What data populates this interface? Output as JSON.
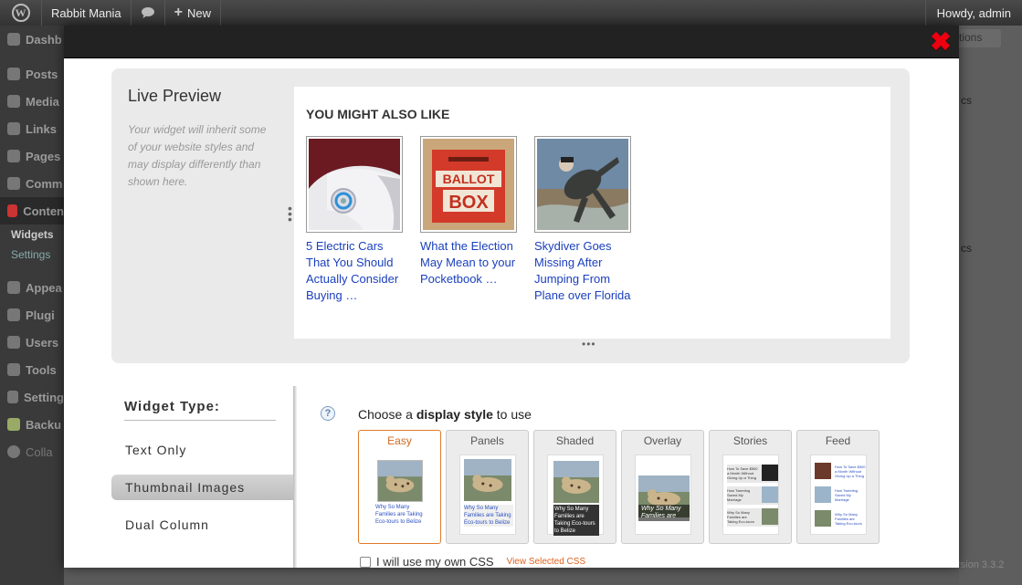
{
  "adminbar": {
    "site_name": "Rabbit Mania",
    "new_label": "New",
    "howdy": "Howdy, admin"
  },
  "background": {
    "sidebar_items": [
      "Dashb",
      "Posts",
      "Media",
      "Links",
      "Pages",
      "Comm",
      "Conten"
    ],
    "sidebar_sub": [
      "Widgets",
      "Settings"
    ],
    "sidebar_items_2": [
      "Appea",
      "Plugi",
      "Users",
      "Tools",
      "Setting",
      "Backu",
      "Colla"
    ],
    "right_text_1": "tions",
    "right_text_2": "cs",
    "right_text_3": "cs",
    "version": "rsion 3.3.2"
  },
  "preview": {
    "title": "Live Preview",
    "note": "Your widget will inherit some of your website styles and may display differently than shown here.",
    "heading": "YOU MIGHT ALSO LIKE",
    "cards": [
      {
        "title": "5 Electric Cars That You Should Actually Consider Buying …"
      },
      {
        "title": "What the Election May Mean to your Pocketbook …"
      },
      {
        "title": "Skydiver Goes Missing After Jumping From Plane over Florida"
      }
    ],
    "ballot_text_1": "BALLOT",
    "ballot_text_2": "BOX"
  },
  "widget_type": {
    "title": "Widget Type:",
    "options": [
      "Text Only",
      "Thumbnail Images",
      "Dual Column"
    ],
    "selected": "Thumbnail Images"
  },
  "display_style": {
    "heading_pre": "Choose a ",
    "heading_bold": "display style",
    "heading_post": " to use",
    "options": [
      "Easy",
      "Panels",
      "Shaded",
      "Overlay",
      "Stories",
      "Feed"
    ],
    "selected": "Easy",
    "mini_caption": "Why So Many Families are Taking Eco-tours to Belize",
    "overlay_caption": "Why So Many Families are"
  },
  "css": {
    "checkbox_label": "I will use my own CSS",
    "link_label": "View Selected CSS"
  },
  "colors": {
    "accent": "#e07b2a",
    "link": "#1a3fbd",
    "close": "#e01010"
  }
}
